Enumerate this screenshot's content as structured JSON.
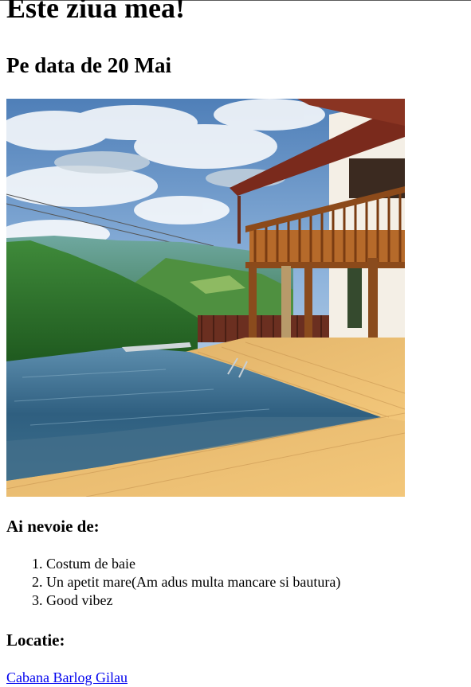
{
  "header": {
    "title": "Este ziua mea!",
    "subtitle": "Pe data de 20 Mai"
  },
  "image": {
    "icon": "cabin-pool-photo"
  },
  "needs": {
    "heading": "Ai nevoie de:",
    "items": [
      "Costum de baie",
      "Un apetit mare(Am adus multa mancare si bautura)",
      "Good vibez"
    ]
  },
  "location": {
    "heading": "Locatie:",
    "link_text": "Cabana Barlog Gilau"
  },
  "colors": {
    "link": "#0000ee",
    "text": "#000000",
    "background": "#ffffff"
  }
}
